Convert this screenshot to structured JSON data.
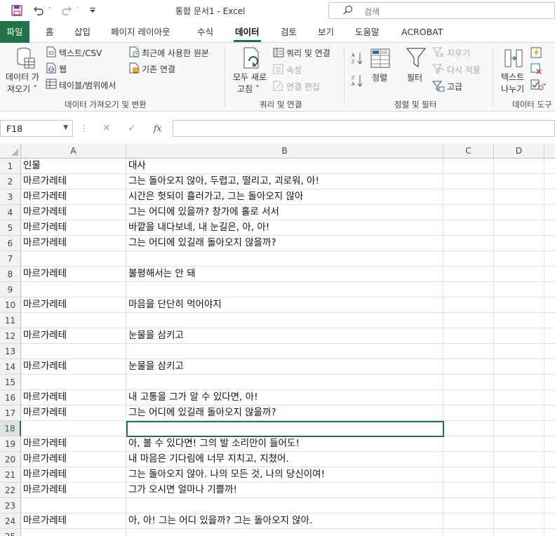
{
  "titlebar": {
    "title": "통합 문서1  -  Excel",
    "search_placeholder": "검색",
    "save_icon": "save-icon",
    "undo_icon": "undo-icon",
    "redo_icon": "redo-icon",
    "customize_icon": "customize-qat-icon"
  },
  "tabs": [
    {
      "label": "파일"
    },
    {
      "label": "홈"
    },
    {
      "label": "삽입"
    },
    {
      "label": "페이지 레이아웃"
    },
    {
      "label": "수식"
    },
    {
      "label": "데이터"
    },
    {
      "label": "검토"
    },
    {
      "label": "보기"
    },
    {
      "label": "도움말"
    },
    {
      "label": "ACROBAT"
    }
  ],
  "active_tab": "데이터",
  "ribbon": {
    "get_data": {
      "label1": "데이터 가",
      "label2": "져오기 ˅"
    },
    "from_text_csv": "텍스트/CSV",
    "from_web": "웹",
    "from_table": "테이블/범위에서",
    "recent_sources": "최근에 사용한 원본",
    "existing_connections": "기존 연결",
    "group_get_transform": "데이터 가져오기 및 변환",
    "refresh_all": {
      "label1": "모두 새로",
      "label2": "고침 ˅"
    },
    "queries_connections": "쿼리 및 연결",
    "properties": "속성",
    "edit_links": "연결 편집",
    "group_queries": "쿼리 및 연결",
    "sort": "정렬",
    "filter": "필터",
    "clear": "지우기",
    "reapply": "다시 적용",
    "advanced": "고급",
    "group_sort_filter": "정렬 및 필터",
    "text_to_columns": {
      "label1": "텍스트",
      "label2": "나누기"
    },
    "group_data_tools": "데이터 도구"
  },
  "formula_bar": {
    "name_box": "F18",
    "formula": "",
    "fx": "fx"
  },
  "sheet": {
    "columns": [
      "A",
      "B",
      "C",
      "D"
    ],
    "selected_row": "18",
    "rows": [
      {
        "n": "1",
        "a": "인물",
        "b": "대사"
      },
      {
        "n": "2",
        "a": "마르가레테",
        "b": "그는 돌아오지 않아, 두렵고, 떨리고, 괴로워, 아!"
      },
      {
        "n": "3",
        "a": "마르가레테",
        "b": "시간은 헛되이 흘러가고, 그는 돌아오지 않아"
      },
      {
        "n": "4",
        "a": "마르가레테",
        "b": "그는 어디에 있을까? 창가에 홀로 서서"
      },
      {
        "n": "5",
        "a": "마르가레테",
        "b": "바깥을 내다보네, 내 눈길은, 아, 아!"
      },
      {
        "n": "6",
        "a": "마르가레테",
        "b": "그는 어디에 있길래 돌아오지 않을까?"
      },
      {
        "n": "7",
        "a": "",
        "b": ""
      },
      {
        "n": "8",
        "a": "마르가레테",
        "b": "불평해서는 안 돼"
      },
      {
        "n": "9",
        "a": "",
        "b": ""
      },
      {
        "n": "10",
        "a": "마르가레테",
        "b": "마음을 단단히 먹어야지"
      },
      {
        "n": "11",
        "a": "",
        "b": ""
      },
      {
        "n": "12",
        "a": "마르가레테",
        "b": "눈물을 삼키고"
      },
      {
        "n": "13",
        "a": "",
        "b": ""
      },
      {
        "n": "14",
        "a": "마르가레테",
        "b": "눈물을 삼키고"
      },
      {
        "n": "15",
        "a": "",
        "b": ""
      },
      {
        "n": "16",
        "a": "마르가레테",
        "b": "내 고통을 그가 알 수 있다면, 아!"
      },
      {
        "n": "17",
        "a": "마르가레테",
        "b": "그는 어디에 있길래 돌아오지 않을까?"
      },
      {
        "n": "18",
        "a": "",
        "b": ""
      },
      {
        "n": "19",
        "a": "마르가레테",
        "b": "아, 볼 수 있다면! 그의 발 소리만이 들어도!"
      },
      {
        "n": "20",
        "a": "마르가레테",
        "b": "내 마음은 기다림에 너무 지치고, 지쳤어."
      },
      {
        "n": "21",
        "a": "마르가레테",
        "b": "그는 돌아오지 않아. 나의 모든 것, 나의 당신이여!"
      },
      {
        "n": "22",
        "a": "마르가레테",
        "b": "그가 오시면 얼마나 기쁠까!"
      },
      {
        "n": "23",
        "a": "",
        "b": ""
      },
      {
        "n": "24",
        "a": "마르가레테",
        "b": "아, 아! 그는 어디 있을까? 그는 돌아오지 않아."
      },
      {
        "n": "25",
        "a": "",
        "b": ""
      }
    ]
  },
  "colors": {
    "excel_green": "#217346",
    "header_bg": "#f2f2f2",
    "ribbon_bg": "#f8f8f8"
  }
}
